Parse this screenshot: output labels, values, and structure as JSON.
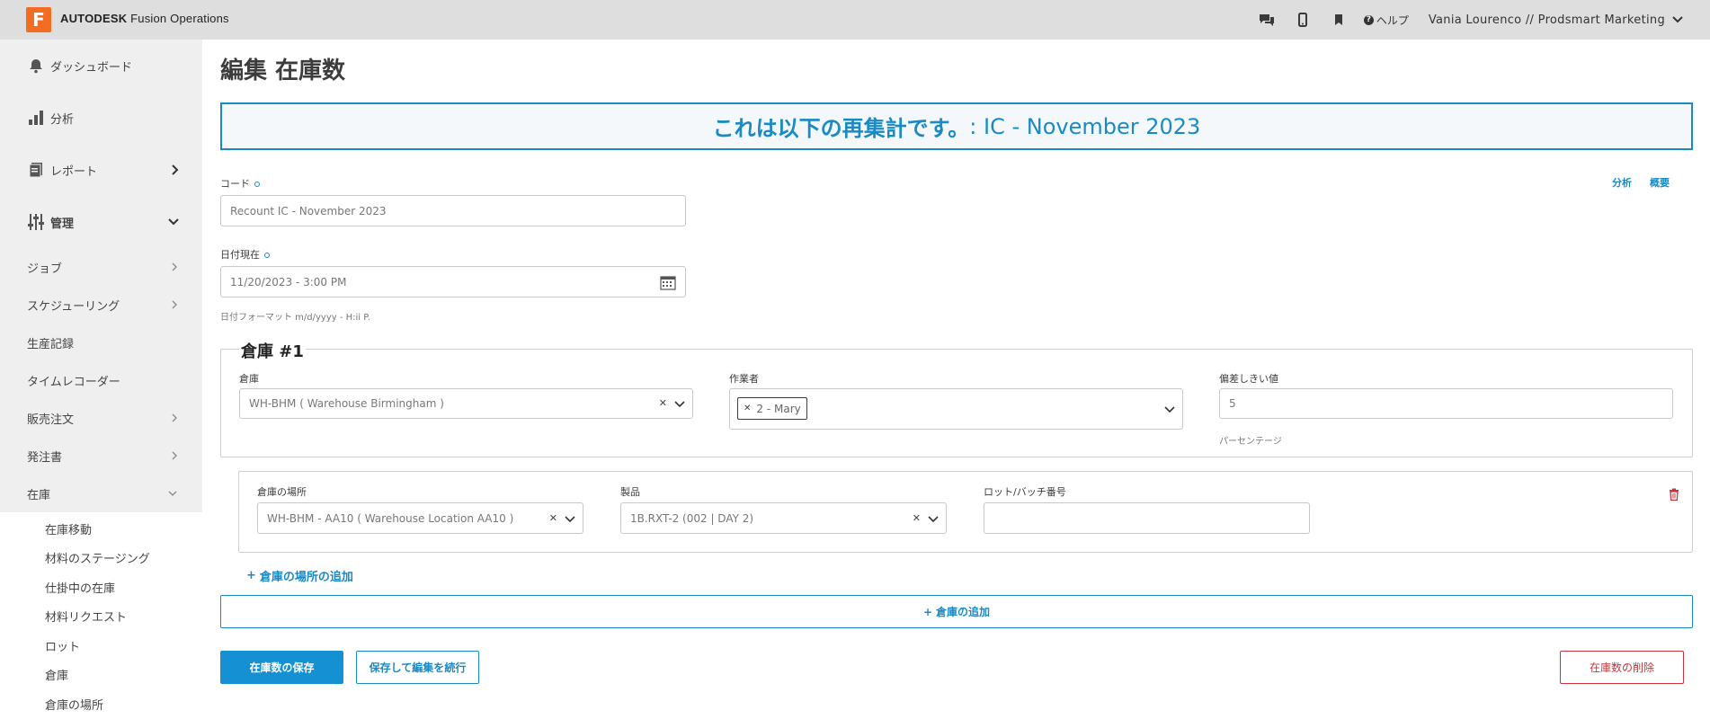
{
  "app": {
    "logo_letter": "F",
    "brand_bold": "AUTODESK",
    "brand_light": "Fusion Operations",
    "help_label": "ヘルプ",
    "user_label": "Vania Lourenco // Prodsmart Marketing"
  },
  "sidebar": {
    "main": [
      {
        "label": "ダッシュボード",
        "icon": "bell-icon"
      },
      {
        "label": "分析",
        "icon": "bar-chart-icon"
      },
      {
        "label": "レポート",
        "icon": "report-icon"
      },
      {
        "label": "管理",
        "icon": "sliders-icon"
      }
    ],
    "sub": [
      {
        "label": "ジョブ"
      },
      {
        "label": "スケジューリング"
      },
      {
        "label": "生産記録"
      },
      {
        "label": "タイムレコーダー"
      },
      {
        "label": "販売注文"
      },
      {
        "label": "発注書"
      },
      {
        "label": "在庫"
      }
    ],
    "inventory": [
      {
        "label": "在庫移動"
      },
      {
        "label": "材料のステージング"
      },
      {
        "label": "仕掛中の在庫"
      },
      {
        "label": "材料リクエスト"
      },
      {
        "label": "ロット"
      },
      {
        "label": "倉庫"
      },
      {
        "label": "倉庫の場所"
      }
    ]
  },
  "page": {
    "title": "編集 在庫数",
    "banner_prefix": "これは以下の再集計です。",
    "banner_value": ": IC - November 2023",
    "link_analysis": "分析",
    "link_summary": "概要",
    "code_label": "コード",
    "code_value": "Recount IC - November 2023",
    "date_label": "日付現在",
    "date_value": "11/20/2023 - 3:00 PM",
    "date_hint": "日付フォーマット m/d/yyyy - H:ii P."
  },
  "warehouse": {
    "legend": "倉庫 #1",
    "warehouse_label": "倉庫",
    "warehouse_value": "WH-BHM ( Warehouse Birmingham )",
    "worker_label": "作業者",
    "worker_tag": "2 - Mary",
    "threshold_label": "偏差しきい値",
    "threshold_value": "5",
    "threshold_hint": "パーセンテージ"
  },
  "location": {
    "location_label": "倉庫の場所",
    "location_value": "WH-BHM - AA10 ( Warehouse Location AA10 )",
    "product_label": "製品",
    "product_value": "1B.RXT-2 (002 | DAY 2)",
    "lot_label": "ロット/バッチ番号",
    "lot_value": ""
  },
  "actions": {
    "add_location": "倉庫の場所の追加",
    "add_warehouse": "倉庫の追加",
    "save": "在庫数の保存",
    "save_continue": "保存して編集を続行",
    "delete": "在庫数の削除"
  }
}
